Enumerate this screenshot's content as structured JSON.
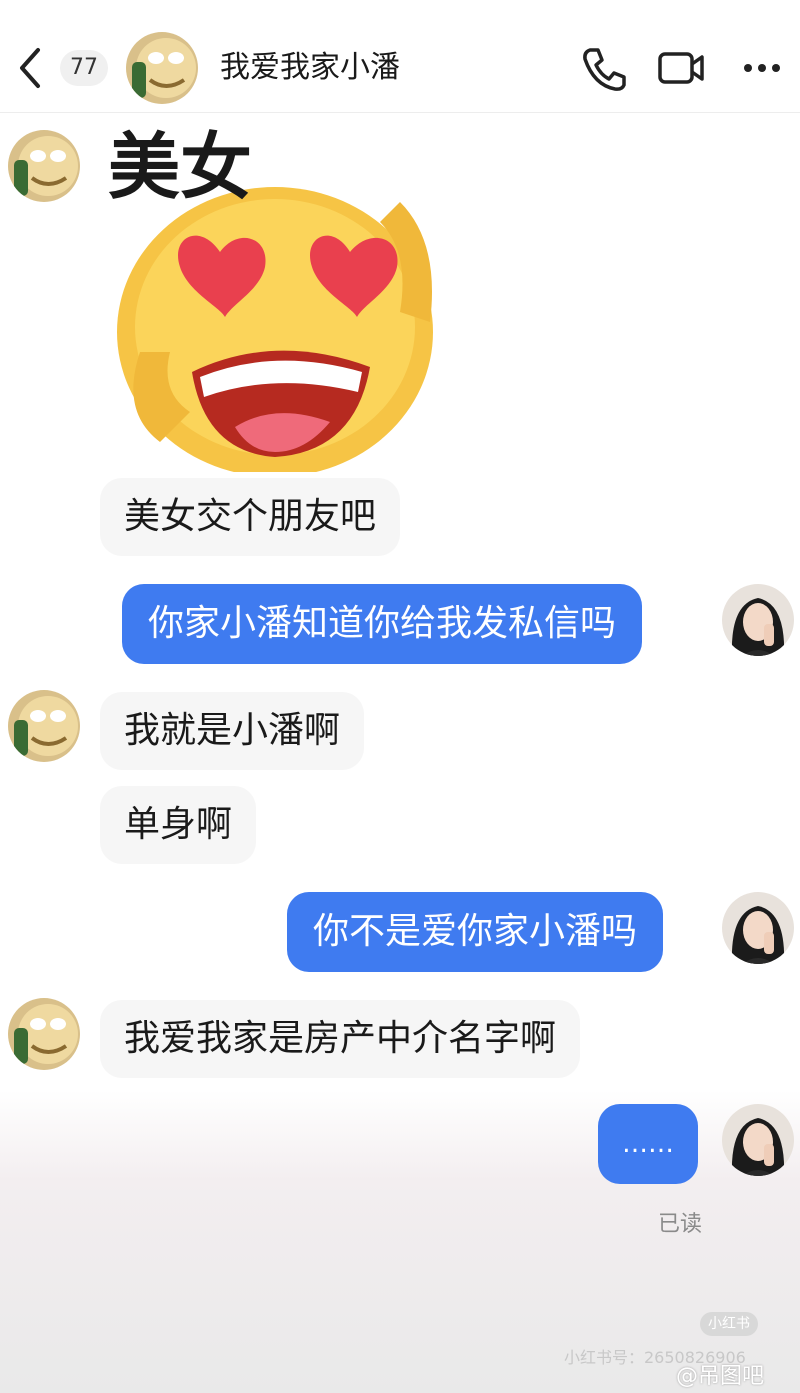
{
  "header": {
    "unread_count": "77",
    "contact_name": "我爱我家小潘"
  },
  "messages": {
    "sticker_caption": "美女",
    "m1": "美女交个朋友吧",
    "m2": "你家小潘知道你给我发私信吗",
    "m3": "我就是小潘啊",
    "m4": "单身啊",
    "m5": "你不是爱你家小潘吗",
    "m6": "我爱我家是房产中介名字啊",
    "m7": "……",
    "read_status": "已读"
  },
  "watermarks": {
    "xhs_badge": "小红书",
    "xhs_id": "小红书号：2650826906",
    "tieba": "@吊图吧"
  },
  "colors": {
    "outgoing_bubble": "#3f7bf0",
    "incoming_bubble": "#f6f6f6"
  },
  "icons": [
    "back-icon",
    "phone-icon",
    "video-call-icon",
    "more-icon"
  ]
}
